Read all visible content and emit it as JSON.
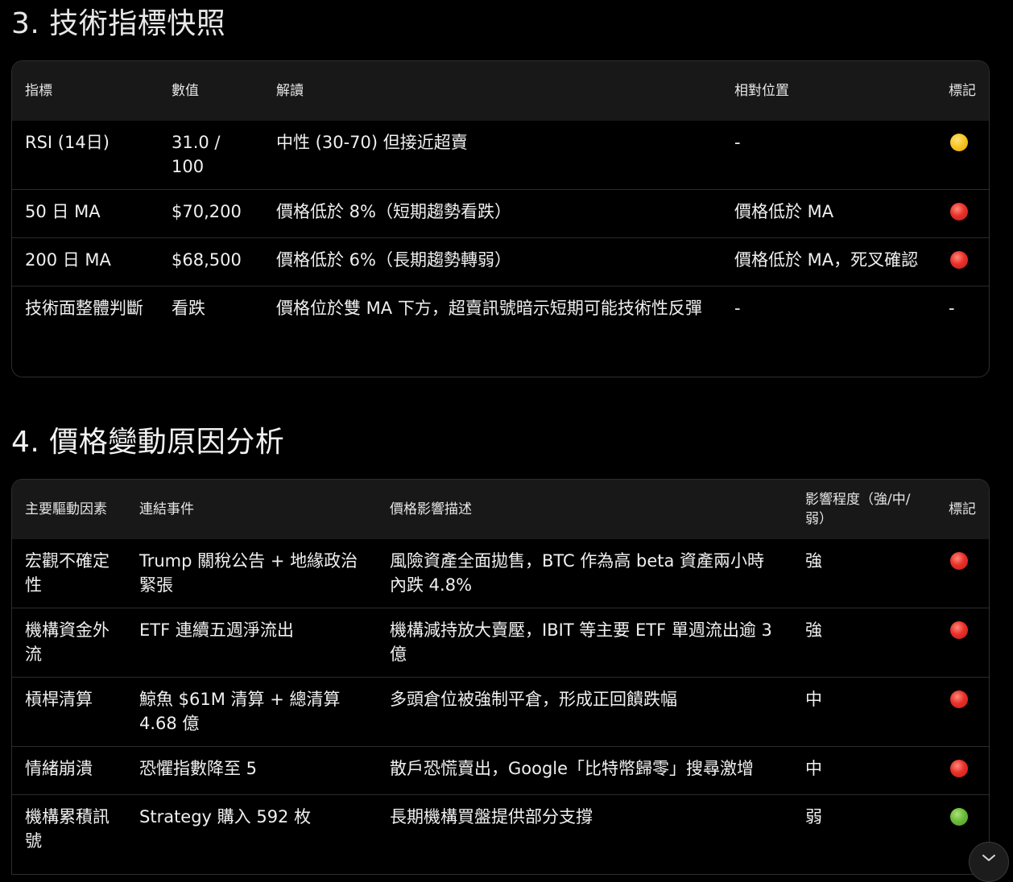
{
  "section3": {
    "title": "3. 技術指標快照",
    "headers": [
      "指標",
      "數值",
      "解讀",
      "相對位置",
      "標記"
    ],
    "rows": [
      {
        "indicator": "RSI (14日)",
        "value": "31.0 / 100",
        "interpretation": "中性 (30-70) 但接近超賣",
        "position": "-",
        "marker": "yellow-circle-icon"
      },
      {
        "indicator": "50 日 MA",
        "value": "$70,200",
        "interpretation": "價格低於 8%（短期趨勢看跌）",
        "position": "價格低於 MA",
        "marker": "red-circle-icon"
      },
      {
        "indicator": "200 日 MA",
        "value": "$68,500",
        "interpretation": "價格低於 6%（長期趨勢轉弱）",
        "position": "價格低於 MA，死叉確認",
        "marker": "red-circle-icon"
      },
      {
        "indicator": "技術面整體判斷",
        "value": "看跌",
        "interpretation": "價格位於雙 MA 下方，超賣訊號暗示短期可能技術性反彈",
        "position": "-",
        "marker_text": "-"
      }
    ]
  },
  "section4": {
    "title": "4. 價格變動原因分析",
    "headers": [
      "主要驅動因素",
      "連結事件",
      "價格影響描述",
      "影響程度（強/中/弱）",
      "標記"
    ],
    "rows": [
      {
        "driver": "宏觀不確定性",
        "event": "Trump 關稅公告 + 地緣政治緊張",
        "impact": "風險資產全面拋售，BTC 作為高 beta 資產兩小時內跌 4.8%",
        "strength": "強",
        "marker": "red-circle-icon"
      },
      {
        "driver": "機構資金外流",
        "event": "ETF 連續五週淨流出",
        "impact": "機構減持放大賣壓，IBIT 等主要 ETF 單週流出逾 3 億",
        "strength": "強",
        "marker": "red-circle-icon"
      },
      {
        "driver": "槓桿清算",
        "event": "鯨魚 $61M 清算 + 總清算 4.68 億",
        "impact": "多頭倉位被強制平倉，形成正回饋跌幅",
        "strength": "中",
        "marker": "red-circle-icon"
      },
      {
        "driver": "情緒崩潰",
        "event": "恐懼指數降至 5",
        "impact": "散戶恐慌賣出，Google「比特幣歸零」搜尋激增",
        "strength": "中",
        "marker": "red-circle-icon"
      },
      {
        "driver": "機構累積訊號",
        "event": "Strategy 購入 592 枚",
        "impact": "長期機構買盤提供部分支撐",
        "strength": "弱",
        "marker": "green-circle-icon"
      }
    ]
  },
  "colors": {
    "background": "#000000",
    "header_row": "#181818",
    "red_marker": "#e8302a",
    "yellow_marker": "#f9c625",
    "green_marker": "#6dbb3a"
  },
  "scroll_button": {
    "icon": "chevron-down-icon"
  }
}
